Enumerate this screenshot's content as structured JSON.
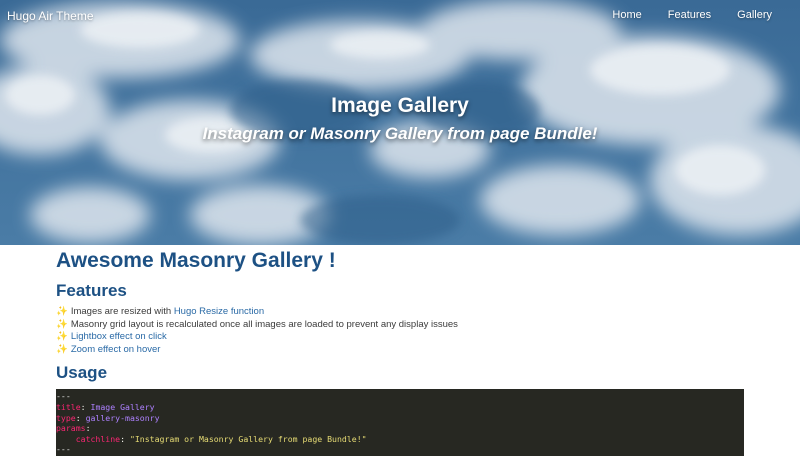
{
  "site": {
    "brand": "Hugo Air Theme",
    "nav": [
      "Home",
      "Features",
      "Gallery"
    ]
  },
  "hero": {
    "title": "Image Gallery",
    "subtitle": "Instagram or Masonry Gallery from page Bundle!"
  },
  "main": {
    "heading": "Awesome Masonry Gallery !",
    "features_heading": "Features",
    "features": [
      {
        "icon": "sparkles-icon",
        "before": "Images are resized with ",
        "link": "Hugo Resize function",
        "after": ""
      },
      {
        "icon": "sparkles-icon",
        "text": "Masonry grid layout is recalculated once all images are loaded to prevent any display issues"
      },
      {
        "icon": "sparkles-icon",
        "text": "Lightbox effect on click"
      },
      {
        "icon": "sparkles-icon",
        "text": "Zoom effect on hover"
      }
    ],
    "usage_heading": "Usage",
    "code": {
      "delimiter": "---",
      "title_key": "title",
      "title_value": "Image Gallery",
      "type_key": "type",
      "type_value": "gallery-masonry",
      "params_key": "params",
      "catchline_key": "catchline",
      "catchline_value": "\"Instagram or Masonry Gallery from page Bundle!\""
    }
  },
  "colors": {
    "heading": "#1d5184",
    "link": "#2a6aa6",
    "code_bg": "#272822",
    "sky": "#3f6f99"
  }
}
